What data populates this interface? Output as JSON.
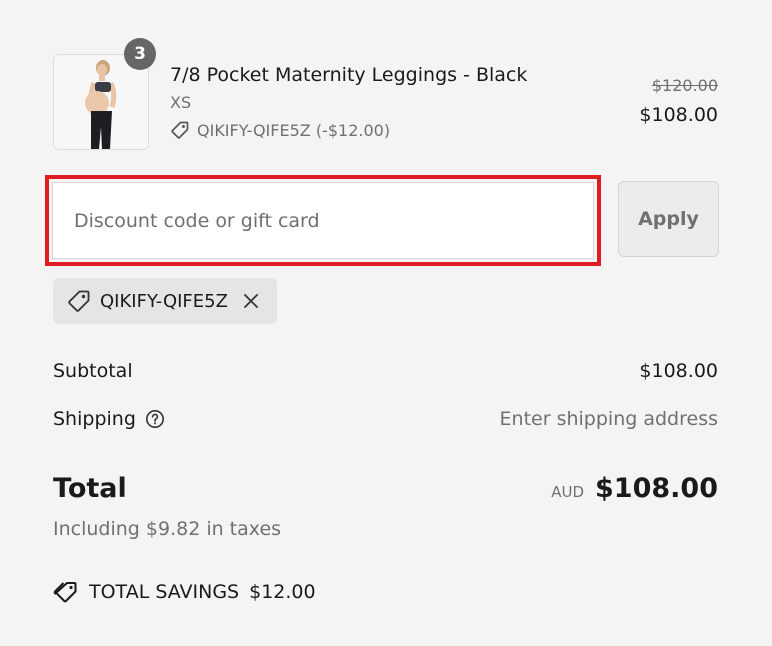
{
  "product": {
    "quantity": "3",
    "title": "7/8 Pocket Maternity Leggings - Black",
    "variant": "XS",
    "discount_line": "QIKIFY-QIFE5Z (-$12.00)",
    "original_price": "$120.00",
    "price": "$108.00",
    "image_icon": "product-photo"
  },
  "discount": {
    "placeholder": "Discount code or gift card",
    "value": "",
    "apply_label": "Apply",
    "applied_code": "QIKIFY-QIFE5Z",
    "highlight_color": "#e01b24"
  },
  "summary": {
    "subtotal_label": "Subtotal",
    "subtotal_value": "$108.00",
    "shipping_label": "Shipping",
    "shipping_value": "Enter shipping address",
    "total_label": "Total",
    "currency": "AUD",
    "total_value": "$108.00",
    "taxes_note": "Including $9.82 in taxes",
    "savings_label": "TOTAL SAVINGS",
    "savings_value": "$12.00"
  }
}
